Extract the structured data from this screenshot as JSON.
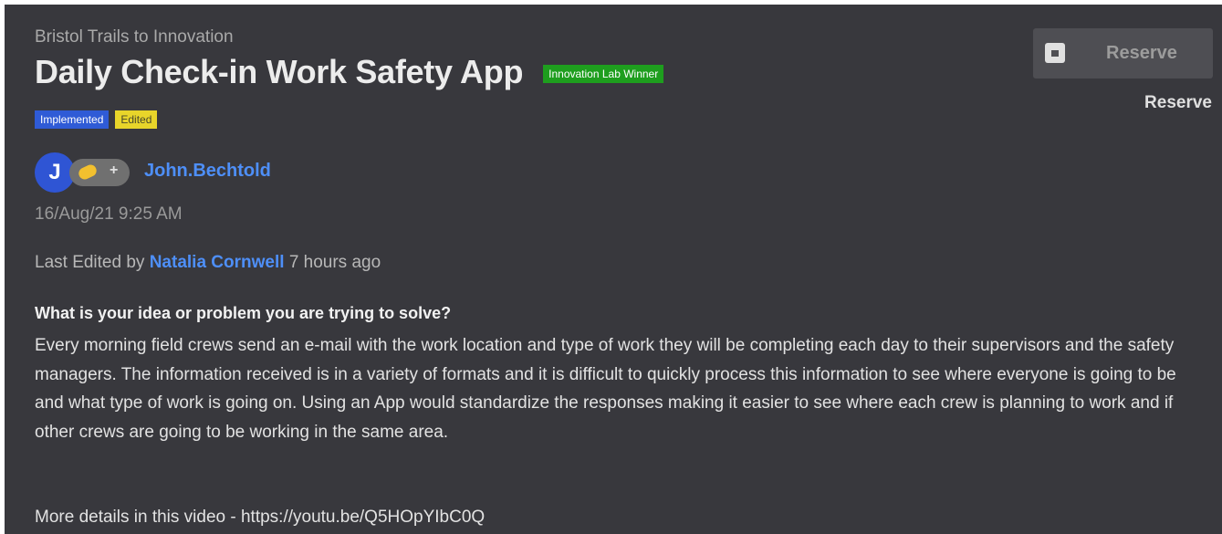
{
  "breadcrumb": "Bristol Trails to Innovation",
  "title": "Daily Check-in Work Safety App",
  "badges": {
    "winner": "Innovation Lab Winner",
    "implemented": "Implemented",
    "edited": "Edited"
  },
  "author": {
    "initial": "J",
    "name": "John.Bechtold",
    "reaction_add": "+"
  },
  "timestamp": "16/Aug/21 9:25 AM",
  "last_edited": {
    "prefix": "Last Edited by",
    "editor": "Natalia Cornwell",
    "suffix": "7 hours ago"
  },
  "question": "What is your idea or problem you are trying to solve?",
  "body": "Every morning field crews send an e-mail with the work location and type of work they will be completing each day to their supervisors and the safety managers. The information received is in a variety of formats and it is difficult to quickly process this information to see where everyone is going to be and what type of work is going on. Using an App would standardize the responses making it easier to see where each crew is planning to work and if other crews are going to be working in the same area.",
  "video_line": "More details in this video - https://youtu.be/Q5HOpYIbC0Q",
  "reserve": {
    "button_label": "Reserve",
    "text": "Reserve"
  },
  "colors": {
    "background": "#38383d",
    "link": "#4e8ff8",
    "winner_badge": "#1e9e1e",
    "implemented_badge": "#2f5bd6",
    "edited_badge": "#e8d52a"
  }
}
